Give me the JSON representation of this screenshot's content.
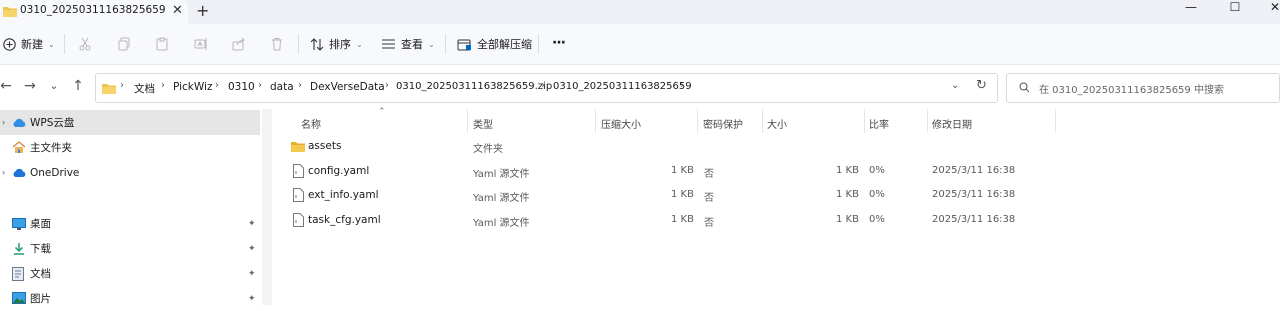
{
  "tab": {
    "title": "0310_20250311163825659",
    "close": "✕",
    "new": "+"
  },
  "window_controls": {
    "minimize": "—",
    "maximize": "☐",
    "close": "✕"
  },
  "toolbar": {
    "new_label": "新建",
    "sort_label": "排序",
    "view_label": "查看",
    "extract_all_label": "全部解压缩",
    "more_label": "···"
  },
  "address": {
    "crumbs": [
      "文档",
      "PickWiz",
      "0310",
      "data",
      "DexVerseData",
      "0310_20250311163825659.zip",
      "0310_20250311163825659"
    ],
    "separator": "›"
  },
  "search": {
    "placeholder": "在 0310_20250311163825659 中搜索"
  },
  "sidebar": {
    "items": [
      {
        "label": "WPS云盘",
        "icon": "cloud-icon",
        "selected": true
      },
      {
        "label": "主文件夹",
        "icon": "home-icon"
      },
      {
        "label": "OneDrive",
        "icon": "onedrive-icon"
      },
      {
        "label": "桌面",
        "icon": "desktop-icon",
        "pinned": true
      },
      {
        "label": "下载",
        "icon": "download-icon",
        "pinned": true
      },
      {
        "label": "文档",
        "icon": "document-icon",
        "pinned": true
      },
      {
        "label": "图片",
        "icon": "picture-icon",
        "pinned": true
      }
    ],
    "pin_glyph": "📌"
  },
  "columns": [
    "名称",
    "类型",
    "压缩大小",
    "密码保护",
    "大小",
    "比率",
    "修改日期"
  ],
  "files": [
    {
      "name": "assets",
      "type": "文件夹",
      "compressed": "",
      "protected": "",
      "size": "",
      "ratio": "",
      "modified": "",
      "icon": "folder-icon"
    },
    {
      "name": "config.yaml",
      "type": "Yaml 源文件",
      "compressed": "1 KB",
      "protected": "否",
      "size": "1 KB",
      "ratio": "0%",
      "modified": "2025/3/11 16:38",
      "icon": "file-icon"
    },
    {
      "name": "ext_info.yaml",
      "type": "Yaml 源文件",
      "compressed": "1 KB",
      "protected": "否",
      "size": "1 KB",
      "ratio": "0%",
      "modified": "2025/3/11 16:38",
      "icon": "file-icon"
    },
    {
      "name": "task_cfg.yaml",
      "type": "Yaml 源文件",
      "compressed": "1 KB",
      "protected": "否",
      "size": "1 KB",
      "ratio": "0%",
      "modified": "2025/3/11 16:38",
      "icon": "file-icon"
    }
  ],
  "colors": {
    "accent": "#0067c0",
    "folder": "#f0c14b",
    "selected_bg": "#e5e5e5",
    "chrome_bg": "#f7f9fc"
  }
}
